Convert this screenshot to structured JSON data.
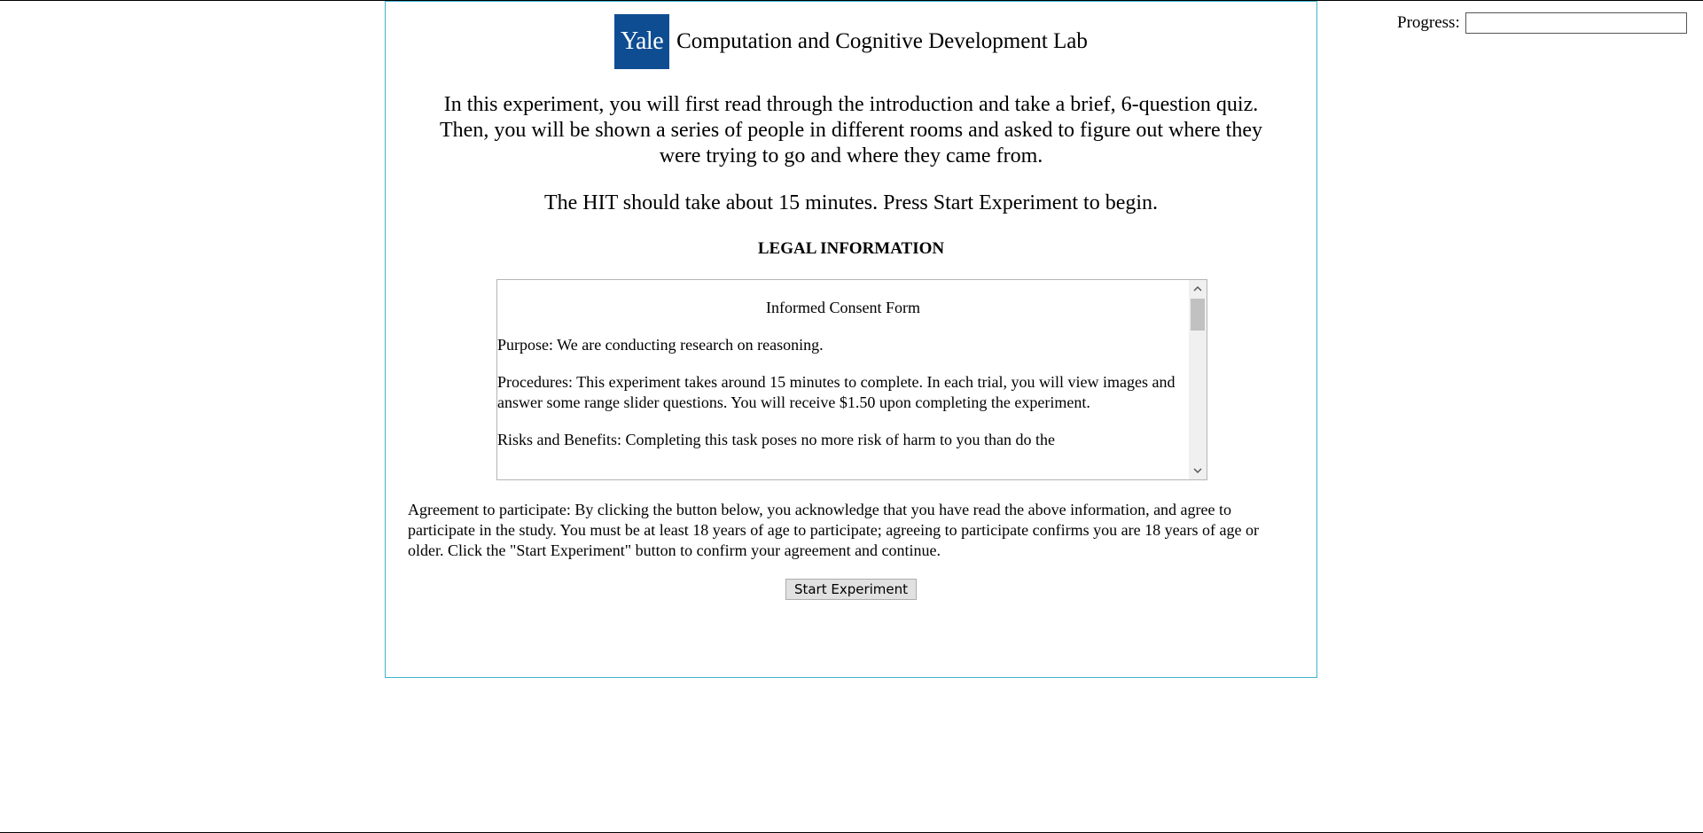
{
  "progress": {
    "label": "Progress:",
    "value": 0
  },
  "header": {
    "logo_text": "Yale",
    "lab_name": "Computation and Cognitive Development Lab"
  },
  "intro": {
    "text": "In this experiment, you will first read through the introduction and take a brief, 6-question quiz. Then, you will be shown a series of people in different rooms and asked to figure out where they were trying to go and where they came from.",
    "duration": "The HIT should take about 15 minutes. Press Start Experiment to begin."
  },
  "legal": {
    "heading": "LEGAL INFORMATION",
    "consent_title": "Informed Consent Form",
    "purpose": "Purpose: We are conducting research on reasoning.",
    "procedures": "Procedures: This experiment takes around 15 minutes to complete. In each trial, you will view images and answer some range slider questions. You will receive $1.50 upon completing the experiment.",
    "risks": "Risks and Benefits: Completing this task poses no more risk of harm to you than do the"
  },
  "agreement": {
    "text": "Agreement to participate: By clicking the button below, you acknowledge that you have read the above information, and agree to participate in the study. You must be at least 18 years of age to participate; agreeing to participate confirms you are 18 years of age or older. Click the \"Start Experiment\" button to confirm your agreement and continue."
  },
  "start_button": {
    "label": "Start Experiment"
  },
  "icons": {
    "scroll_up": "chevron-up-icon",
    "scroll_down": "chevron-down-icon"
  },
  "colors": {
    "yale_blue": "#0f4d92",
    "panel_border": "#3fb3cf"
  }
}
